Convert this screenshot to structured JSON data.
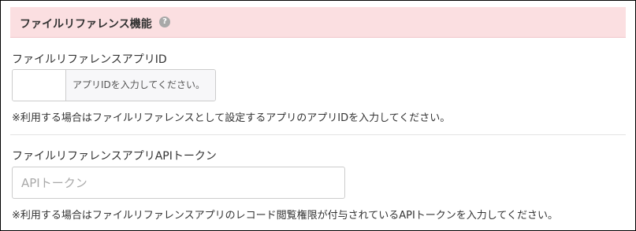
{
  "section": {
    "title": "ファイルリファレンス機能",
    "help_icon_glyph": "?"
  },
  "app_id_field": {
    "label": "ファイルリファレンスアプリID",
    "value": "",
    "addon_text": "アプリIDを入力してください。",
    "note": "※利用する場合はファイルリファレンスとして設定するアプリのアプリIDを入力してください。"
  },
  "api_token_field": {
    "label": "ファイルリファレンスアプリAPIトークン",
    "value": "",
    "placeholder": "APIトークン",
    "note": "※利用する場合はファイルリファレンスアプリのレコード閲覧権限が付与されているAPIトークンを入力してください。"
  },
  "colors": {
    "header_background": "#fbdfe1",
    "help_icon": "#a8a8a8",
    "border": "#cccccc"
  }
}
